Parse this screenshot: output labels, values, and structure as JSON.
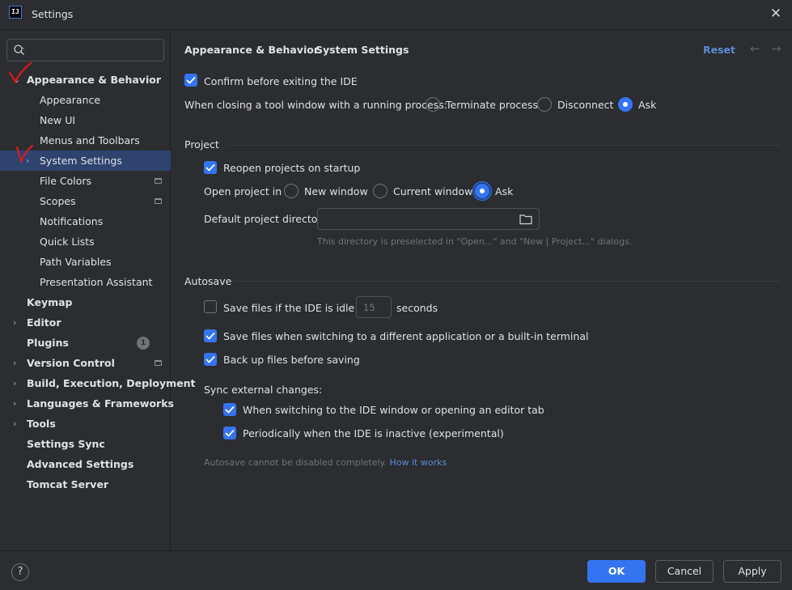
{
  "window": {
    "title": "Settings",
    "app_icon_text": "IJ"
  },
  "search": {
    "placeholder": ""
  },
  "sidebar": {
    "items": [
      {
        "label": "Appearance & Behavior",
        "level": 0,
        "chevron": "expanded"
      },
      {
        "label": "Appearance",
        "level": 1
      },
      {
        "label": "New UI",
        "level": 1
      },
      {
        "label": "Menus and Toolbars",
        "level": 1
      },
      {
        "label": "System Settings",
        "level": 1,
        "chevron": "collapsed",
        "selected": true
      },
      {
        "label": "File Colors",
        "level": 1,
        "project_icon": true
      },
      {
        "label": "Scopes",
        "level": 1,
        "project_icon": true
      },
      {
        "label": "Notifications",
        "level": 1
      },
      {
        "label": "Quick Lists",
        "level": 1
      },
      {
        "label": "Path Variables",
        "level": 1
      },
      {
        "label": "Presentation Assistant",
        "level": 1
      },
      {
        "label": "Keymap",
        "level": 0
      },
      {
        "label": "Editor",
        "level": 0,
        "chevron": "collapsed"
      },
      {
        "label": "Plugins",
        "level": 0,
        "badge": "1"
      },
      {
        "label": "Version Control",
        "level": 0,
        "chevron": "collapsed",
        "project_icon": true
      },
      {
        "label": "Build, Execution, Deployment",
        "level": 0,
        "chevron": "collapsed"
      },
      {
        "label": "Languages & Frameworks",
        "level": 0,
        "chevron": "collapsed"
      },
      {
        "label": "Tools",
        "level": 0,
        "chevron": "collapsed"
      },
      {
        "label": "Settings Sync",
        "level": 0
      },
      {
        "label": "Advanced Settings",
        "level": 0
      },
      {
        "label": "Tomcat Server",
        "level": 0
      }
    ]
  },
  "header": {
    "breadcrumb_parent": "Appearance & Behavior",
    "breadcrumb_current": "System Settings",
    "reset_label": "Reset"
  },
  "general": {
    "confirm_exit": {
      "label": "Confirm before exiting the IDE",
      "checked": true
    },
    "closing_tool_window_label": "When closing a tool window with a running process:",
    "closing_options": [
      {
        "label": "Terminate process",
        "selected": false
      },
      {
        "label": "Disconnect",
        "selected": false
      },
      {
        "label": "Ask",
        "selected": true
      }
    ]
  },
  "project": {
    "section_title": "Project",
    "reopen": {
      "label": "Reopen projects on startup",
      "checked": true
    },
    "open_in_label": "Open project in",
    "open_in_options": [
      {
        "label": "New window",
        "selected": false
      },
      {
        "label": "Current window",
        "selected": false
      },
      {
        "label": "Ask",
        "selected": true
      }
    ],
    "default_dir_label": "Default project directory:",
    "default_dir_value": "",
    "default_dir_hint": "This directory is preselected in \"Open...\" and \"New | Project...\" dialogs."
  },
  "autosave": {
    "section_title": "Autosave",
    "idle": {
      "label_before": "Save files if the IDE is idle for",
      "value": "15",
      "label_after": "seconds",
      "checked": false
    },
    "switching": {
      "label": "Save files when switching to a different application or a built-in terminal",
      "checked": true
    },
    "backup": {
      "label": "Back up files before saving",
      "checked": true
    },
    "sync_label": "Sync external changes:",
    "sync_switch": {
      "label": "When switching to the IDE window or opening an editor tab",
      "checked": true
    },
    "sync_periodic": {
      "label": "Periodically when the IDE is inactive (experimental)",
      "checked": true
    },
    "note": "Autosave cannot be disabled completely.",
    "note_link": "How it works"
  },
  "buttons": {
    "help": "?",
    "ok": "OK",
    "cancel": "Cancel",
    "apply": "Apply"
  },
  "colors": {
    "accent": "#3574f0",
    "link": "#5d8bd6",
    "selection": "#2e436e",
    "annotation": "#e0191f"
  },
  "icons": [
    "search-icon",
    "close-icon",
    "chevron-right-icon",
    "folder-icon",
    "project-scope-icon",
    "help-icon",
    "back-arrow-icon",
    "forward-arrow-icon"
  ]
}
